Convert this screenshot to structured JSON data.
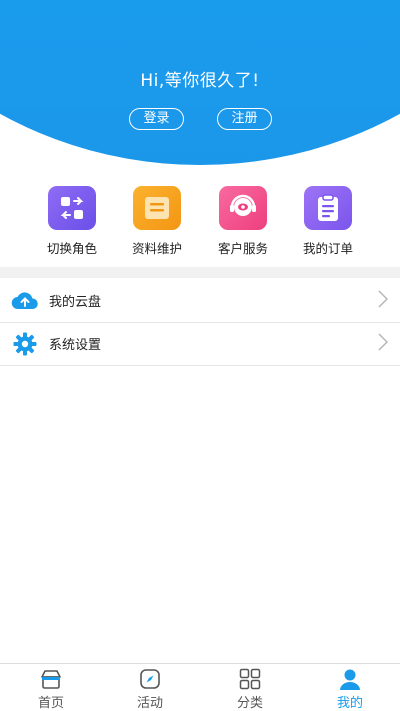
{
  "header": {
    "greeting": "Hi,等你很久了!",
    "login_label": "登录",
    "register_label": "注册"
  },
  "quick_actions": [
    {
      "label": "切换角色",
      "icon": "switch-role-icon",
      "color": "#7b5ef0"
    },
    {
      "label": "资料维护",
      "icon": "profile-maintenance-icon",
      "color": "#f6a31b"
    },
    {
      "label": "客户服务",
      "icon": "customer-service-icon",
      "color": "#f24b8b"
    },
    {
      "label": "我的订单",
      "icon": "order-clipboard-icon",
      "color": "#8a63f2"
    }
  ],
  "menu": [
    {
      "label": "我的云盘",
      "icon": "cloud-upload-icon"
    },
    {
      "label": "系统设置",
      "icon": "gear-icon"
    }
  ],
  "tabbar": {
    "tabs": [
      {
        "label": "首页",
        "icon": "home-icon"
      },
      {
        "label": "活动",
        "icon": "compass-icon"
      },
      {
        "label": "分类",
        "icon": "grid-icon"
      },
      {
        "label": "我的",
        "icon": "user-icon"
      }
    ],
    "active": "我的"
  },
  "colors": {
    "brand_blue": "#1ea8f2",
    "active_tab": "#1a9bea"
  }
}
